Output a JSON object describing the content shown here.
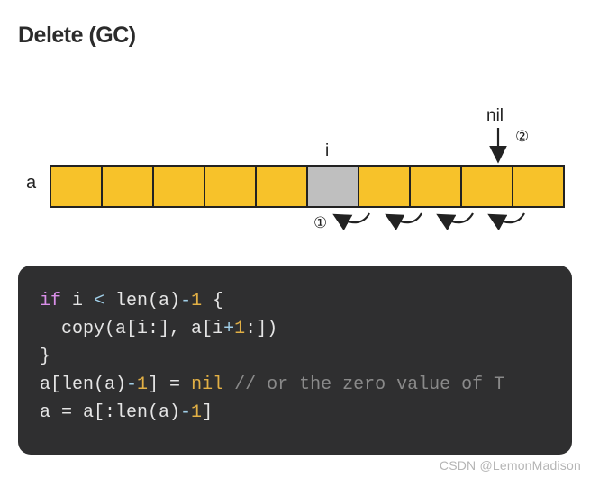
{
  "title": "Delete (GC)",
  "diagram": {
    "array_label": "a",
    "index_label": "i",
    "nil_label": "nil",
    "step1": "①",
    "step2": "②",
    "cell_count": 10,
    "gray_index": 5
  },
  "code": {
    "l1_if": "if",
    "l1_rest_a": " i ",
    "l1_lt": "<",
    "l1_rest_b": " len(a)",
    "l1_minus": "-",
    "l1_one": "1",
    "l1_brace": " {",
    "l2_indent": "  ",
    "l2_copy": "copy",
    "l2_args_a": "(a[i:], a[i",
    "l2_plus": "+",
    "l2_one": "1",
    "l2_args_b": ":])",
    "l3_brace": "}",
    "l4_a": "a[len(a)",
    "l4_minus": "-",
    "l4_one": "1",
    "l4_b": "] = ",
    "l4_nil": "nil",
    "l4_cm": " // or the zero value of T",
    "l5_a": "a = a[:len(a)",
    "l5_minus": "-",
    "l5_one": "1",
    "l5_b": "]"
  },
  "watermark": "CSDN @LemonMadison"
}
